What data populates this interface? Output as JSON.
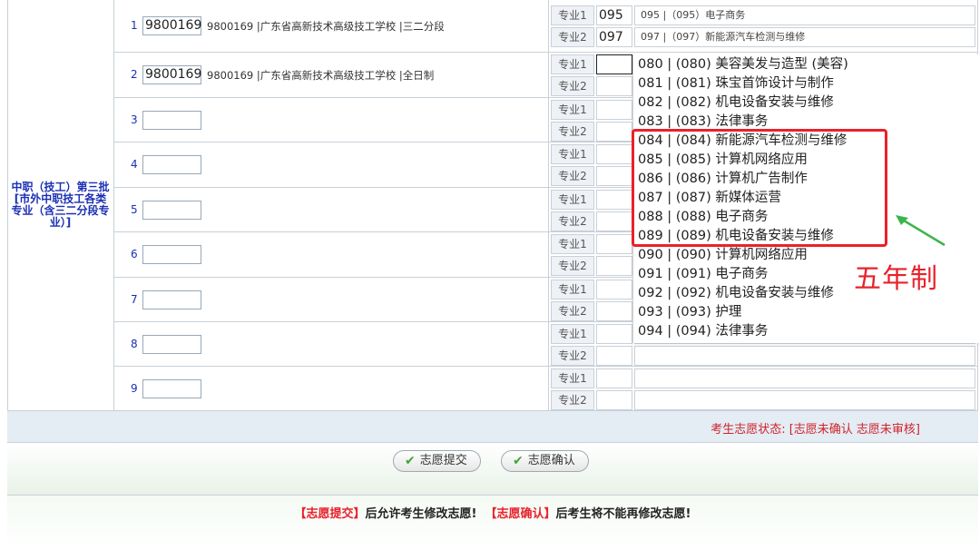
{
  "category": "中职（技工）第三批[市外中职技工各类专业（含三二分段专业）]",
  "rows": [
    {
      "num": "1",
      "code": "9800169",
      "school": "9800169 |广东省高新技术高级技工学校 |三二分段",
      "majors": [
        {
          "label": "专业1",
          "code": "095",
          "name": "095 |（095）电子商务"
        },
        {
          "label": "专业2",
          "code": "097",
          "name": "097 |（097）新能源汽车检测与维修"
        }
      ]
    },
    {
      "num": "2",
      "code": "9800169",
      "school": "9800169 |广东省高新技术高级技工学校 |全日制",
      "majors": [
        {
          "label": "专业1",
          "code": "",
          "name": ""
        },
        {
          "label": "专业2",
          "code": "",
          "name": ""
        }
      ]
    },
    {
      "num": "3",
      "code": "",
      "school": "",
      "majors": [
        {
          "label": "专业1",
          "code": "",
          "name": ""
        },
        {
          "label": "专业2",
          "code": "",
          "name": ""
        }
      ]
    },
    {
      "num": "4",
      "code": "",
      "school": "",
      "majors": [
        {
          "label": "专业1",
          "code": "",
          "name": ""
        },
        {
          "label": "专业2",
          "code": "",
          "name": ""
        }
      ]
    },
    {
      "num": "5",
      "code": "",
      "school": "",
      "majors": [
        {
          "label": "专业1",
          "code": "",
          "name": ""
        },
        {
          "label": "专业2",
          "code": "",
          "name": ""
        }
      ]
    },
    {
      "num": "6",
      "code": "",
      "school": "",
      "majors": [
        {
          "label": "专业1",
          "code": "",
          "name": ""
        },
        {
          "label": "专业2",
          "code": "",
          "name": ""
        }
      ]
    },
    {
      "num": "7",
      "code": "",
      "school": "",
      "majors": [
        {
          "label": "专业1",
          "code": "",
          "name": ""
        },
        {
          "label": "专业2",
          "code": "",
          "name": ""
        }
      ]
    },
    {
      "num": "8",
      "code": "",
      "school": "",
      "majors": [
        {
          "label": "专业1",
          "code": "",
          "name": ""
        },
        {
          "label": "专业2",
          "code": "",
          "name": ""
        }
      ]
    },
    {
      "num": "9",
      "code": "",
      "school": "",
      "majors": [
        {
          "label": "专业1",
          "code": "",
          "name": ""
        },
        {
          "label": "专业2",
          "code": "",
          "name": ""
        }
      ]
    }
  ],
  "dropdown": [
    "080 | (080) 美容美发与造型 (美容)",
    "081 | (081) 珠宝首饰设计与制作",
    "082 | (082) 机电设备安装与维修",
    "083 | (083) 法律事务",
    "084 | (084) 新能源汽车检测与维修",
    "085 | (085) 计算机网络应用",
    "086 | (086) 计算机广告制作",
    "087 | (087) 新媒体运营",
    "088 | (088) 电子商务",
    "089 | (089) 机电设备安装与维修",
    "090 | (090) 计算机网络应用",
    "091 | (091) 电子商务",
    "092 | (092) 机电设备安装与维修",
    "093 | (093) 护理",
    "094 | (094) 法律事务"
  ],
  "annotation": "五年制",
  "status": "考生志愿状态: [志愿未确认  志愿未审核]",
  "buttons": {
    "submit": "志愿提交",
    "confirm": "志愿确认"
  },
  "notice": {
    "part1": "【志愿提交】",
    "part2": "后允许考生修改志愿!",
    "part3": "【志愿确认】",
    "part4": "后考生将不能再修改志愿!"
  },
  "colors": {
    "accent_red": "#e8222b",
    "category_blue": "#1a2fb4",
    "check_green": "#3aa63a"
  }
}
